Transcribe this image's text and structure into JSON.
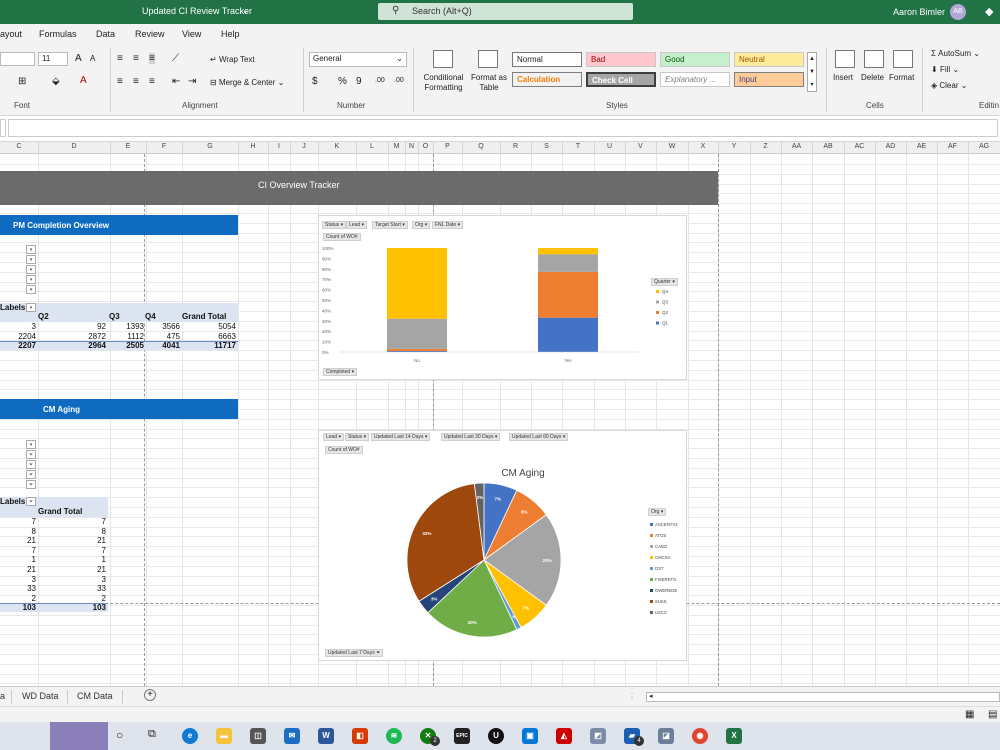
{
  "window": {
    "title": "Updated CI Review Tracker",
    "search_placeholder": "Search (Alt+Q)",
    "user_name": "Aaron Bimler",
    "user_initials": "AB"
  },
  "menu": {
    "tabs": [
      "ayout",
      "Formulas",
      "Data",
      "Review",
      "View",
      "Help"
    ]
  },
  "ribbon": {
    "font": {
      "size": "11",
      "grow": "A",
      "shrink": "A",
      "group_label": "Font"
    },
    "alignment": {
      "wrap_text": "Wrap Text",
      "merge_center": "Merge & Center",
      "group_label": "Alignment"
    },
    "number": {
      "format": "General",
      "currency": "$",
      "percent": "%",
      "comma": "9",
      "inc_dec": ".00",
      "dec_dec": ".00",
      "group_label": "Number"
    },
    "styles": {
      "conditional_formatting": "Conditional Formatting",
      "format_as_table": "Format as Table",
      "normal": "Normal",
      "bad": "Bad",
      "good": "Good",
      "neutral": "Neutral",
      "calculation": "Calculation",
      "check_cell": "Check Cell",
      "explanatory": "Explanatory ...",
      "input": "Input",
      "group_label": "Styles"
    },
    "cells": {
      "insert": "Insert",
      "delete": "Delete",
      "format": "Format",
      "group_label": "Cells"
    },
    "editing": {
      "autosum": "AutoSum",
      "fill": "Fill",
      "clear": "Clear",
      "group_label": "Editin"
    },
    "colors": {
      "bad_bg": "#ffc7ce",
      "bad_fg": "#9c0006",
      "good_bg": "#c6efce",
      "good_fg": "#006100",
      "neutral_bg": "#ffeb9c",
      "neutral_fg": "#9c5700",
      "calc_fg": "#fa7d00",
      "check_bg": "#a5a5a5",
      "input_bg": "#ffcc99",
      "input_fg": "#3f3f76"
    }
  },
  "columns": [
    "C",
    "D",
    "E",
    "F",
    "G",
    "H",
    "I",
    "J",
    "K",
    "L",
    "M",
    "N",
    "O",
    "P",
    "Q",
    "R",
    "S",
    "T",
    "U",
    "V",
    "W",
    "X",
    "Y",
    "Z",
    "AA",
    "AB",
    "AC",
    "AD",
    "AE",
    "AF",
    "AG"
  ],
  "sheet": {
    "banner_title": "CI Overview Tracker",
    "pm_header": "PM Completion Overview",
    "cm_header": "CM Aging",
    "pm_pivot": {
      "row_labels": "Labels",
      "col_headers": [
        "Q2",
        "Q3",
        "Q4",
        "Grand Total"
      ],
      "rows": [
        [
          "3",
          "92",
          "1393",
          "3566",
          "5054"
        ],
        [
          "2204",
          "2872",
          "1112",
          "475",
          "6663"
        ]
      ],
      "total": [
        "2207",
        "2964",
        "2505",
        "4041",
        "11717"
      ]
    },
    "cm_pivot": {
      "row_labels": "Labels",
      "col_header": "Grand Total",
      "rows": [
        [
          "7",
          "7"
        ],
        [
          "8",
          "8"
        ],
        [
          "21",
          "21"
        ],
        [
          "7",
          "7"
        ],
        [
          "1",
          "1"
        ],
        [
          "21",
          "21"
        ],
        [
          "3",
          "3"
        ],
        [
          "33",
          "33"
        ],
        [
          "2",
          "2"
        ]
      ],
      "total": [
        "103",
        "103"
      ]
    }
  },
  "bar_chart_ui": {
    "filters": [
      "Status",
      "Lead",
      "Target Start",
      "Org",
      "FNL Date"
    ],
    "value_field": "Count of WO#",
    "axis_field": "Completed",
    "legend_title": "Quarter"
  },
  "pie_chart_ui": {
    "filters": [
      "Lead",
      "Status",
      "Updated Last 14 Days",
      "Updated Last 30 Days",
      "Updated Last 60 Days"
    ],
    "value_field": "Count of WO#",
    "axis_field": "Updated Last 7 Days",
    "legend_title": "Org"
  },
  "chart_data": [
    {
      "type": "bar",
      "stacked": "100%",
      "title": "",
      "categories": [
        "No",
        "Yes"
      ],
      "yticks": [
        "100%",
        "90%",
        "80%",
        "70%",
        "60%",
        "50%",
        "40%",
        "30%",
        "20%",
        "10%",
        "0%"
      ],
      "ylim": [
        0,
        100
      ],
      "legend_position": "right",
      "series": [
        {
          "name": "Q4",
          "color": "#ffc000",
          "values": [
            68,
            6
          ]
        },
        {
          "name": "Q3",
          "color": "#a5a5a5",
          "values": [
            29,
            17
          ]
        },
        {
          "name": "Q2",
          "color": "#ed7d31",
          "values": [
            2,
            44
          ]
        },
        {
          "name": "Q1",
          "color": "#4472c4",
          "values": [
            1,
            33
          ]
        }
      ]
    },
    {
      "type": "pie",
      "title": "CM Aging",
      "legend_position": "right",
      "slices": [
        {
          "name": "ASCENTV2",
          "color": "#4472c4",
          "value": 7,
          "label": "7%"
        },
        {
          "name": "ATOS",
          "color": "#ed7d31",
          "value": 8,
          "label": "8%"
        },
        {
          "name": "CABO",
          "color": "#a5a5a5",
          "value": 20,
          "label": "20%"
        },
        {
          "name": "CMCSA",
          "color": "#ffc000",
          "value": 7,
          "label": "7%"
        },
        {
          "name": "DST",
          "color": "#5b9bd5",
          "value": 1,
          "label": "1%"
        },
        {
          "name": "FISERETG",
          "color": "#70ad47",
          "value": 20,
          "label": "20%"
        },
        {
          "name": "OWEREDE",
          "color": "#264478",
          "value": 3,
          "label": "3%"
        },
        {
          "name": "SUKK",
          "color": "#9e480e",
          "value": 32,
          "label": "32%"
        },
        {
          "name": "USCC",
          "color": "#636363",
          "value": 2,
          "label": "2%"
        }
      ]
    }
  ],
  "sheet_tabs": [
    "a",
    "WD Data",
    "CM Data"
  ],
  "taskbar": {
    "icons": [
      "search-icon",
      "task-view-icon",
      "edge-icon",
      "explorer-icon",
      "store-icon",
      "mail-icon",
      "word-icon",
      "office-icon",
      "spotify-icon",
      "xbox-icon",
      "epic-icon",
      "unreal-icon",
      "app-icon",
      "adobe-icon",
      "app2-icon",
      "app3-icon",
      "chrome-icon",
      "excel-icon"
    ],
    "xbox_badge": "2",
    "app3_badge": "4"
  }
}
